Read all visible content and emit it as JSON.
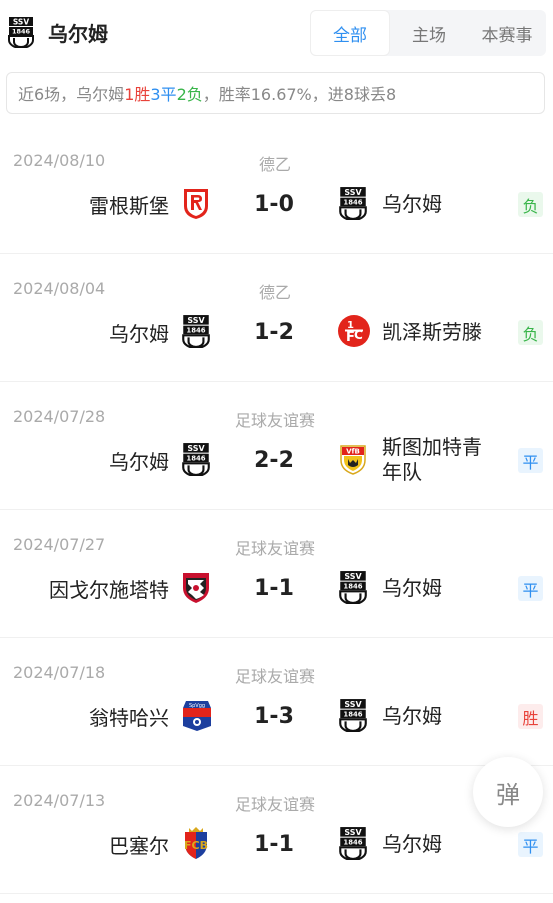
{
  "header": {
    "team_name": "乌尔姆",
    "tabs": [
      {
        "label": "全部",
        "active": true
      },
      {
        "label": "主场",
        "active": false
      },
      {
        "label": "本赛事",
        "active": false
      }
    ]
  },
  "summary": {
    "prefix": "近6场，乌尔姆",
    "wins": "1胜",
    "draws": "3平",
    "losses": "2负",
    "suffix": "，胜率16.67%，进8球丢8"
  },
  "matches": [
    {
      "date": "2024/08/10",
      "competition": "德乙",
      "home": "雷根斯堡",
      "home_logo": "regensburg-logo",
      "score": "1-0",
      "away": "乌尔姆",
      "away_logo": "ulm-logo",
      "result": "负",
      "result_type": "loss"
    },
    {
      "date": "2024/08/04",
      "competition": "德乙",
      "home": "乌尔姆",
      "home_logo": "ulm-logo",
      "score": "1-2",
      "away": "凯泽斯劳滕",
      "away_logo": "kaiserslautern-logo",
      "result": "负",
      "result_type": "loss"
    },
    {
      "date": "2024/07/28",
      "competition": "足球友谊赛",
      "home": "乌尔姆",
      "home_logo": "ulm-logo",
      "score": "2-2",
      "away": "斯图加特青年队",
      "away_logo": "stuttgart-logo",
      "result": "平",
      "result_type": "draw"
    },
    {
      "date": "2024/07/27",
      "competition": "足球友谊赛",
      "home": "因戈尔施塔特",
      "home_logo": "ingolstadt-logo",
      "score": "1-1",
      "away": "乌尔姆",
      "away_logo": "ulm-logo",
      "result": "平",
      "result_type": "draw"
    },
    {
      "date": "2024/07/18",
      "competition": "足球友谊赛",
      "home": "翁特哈兴",
      "home_logo": "unterhaching-logo",
      "score": "1-3",
      "away": "乌尔姆",
      "away_logo": "ulm-logo",
      "result": "胜",
      "result_type": "win"
    },
    {
      "date": "2024/07/13",
      "competition": "足球友谊赛",
      "home": "巴塞尔",
      "home_logo": "basel-logo",
      "score": "1-1",
      "away": "乌尔姆",
      "away_logo": "ulm-logo",
      "result": "平",
      "result_type": "draw"
    }
  ],
  "float_button": {
    "label": "弹"
  },
  "colors": {
    "accent": "#2f8ff0",
    "win": "#e8423a",
    "draw": "#2f8ff0",
    "loss": "#39b54a"
  }
}
